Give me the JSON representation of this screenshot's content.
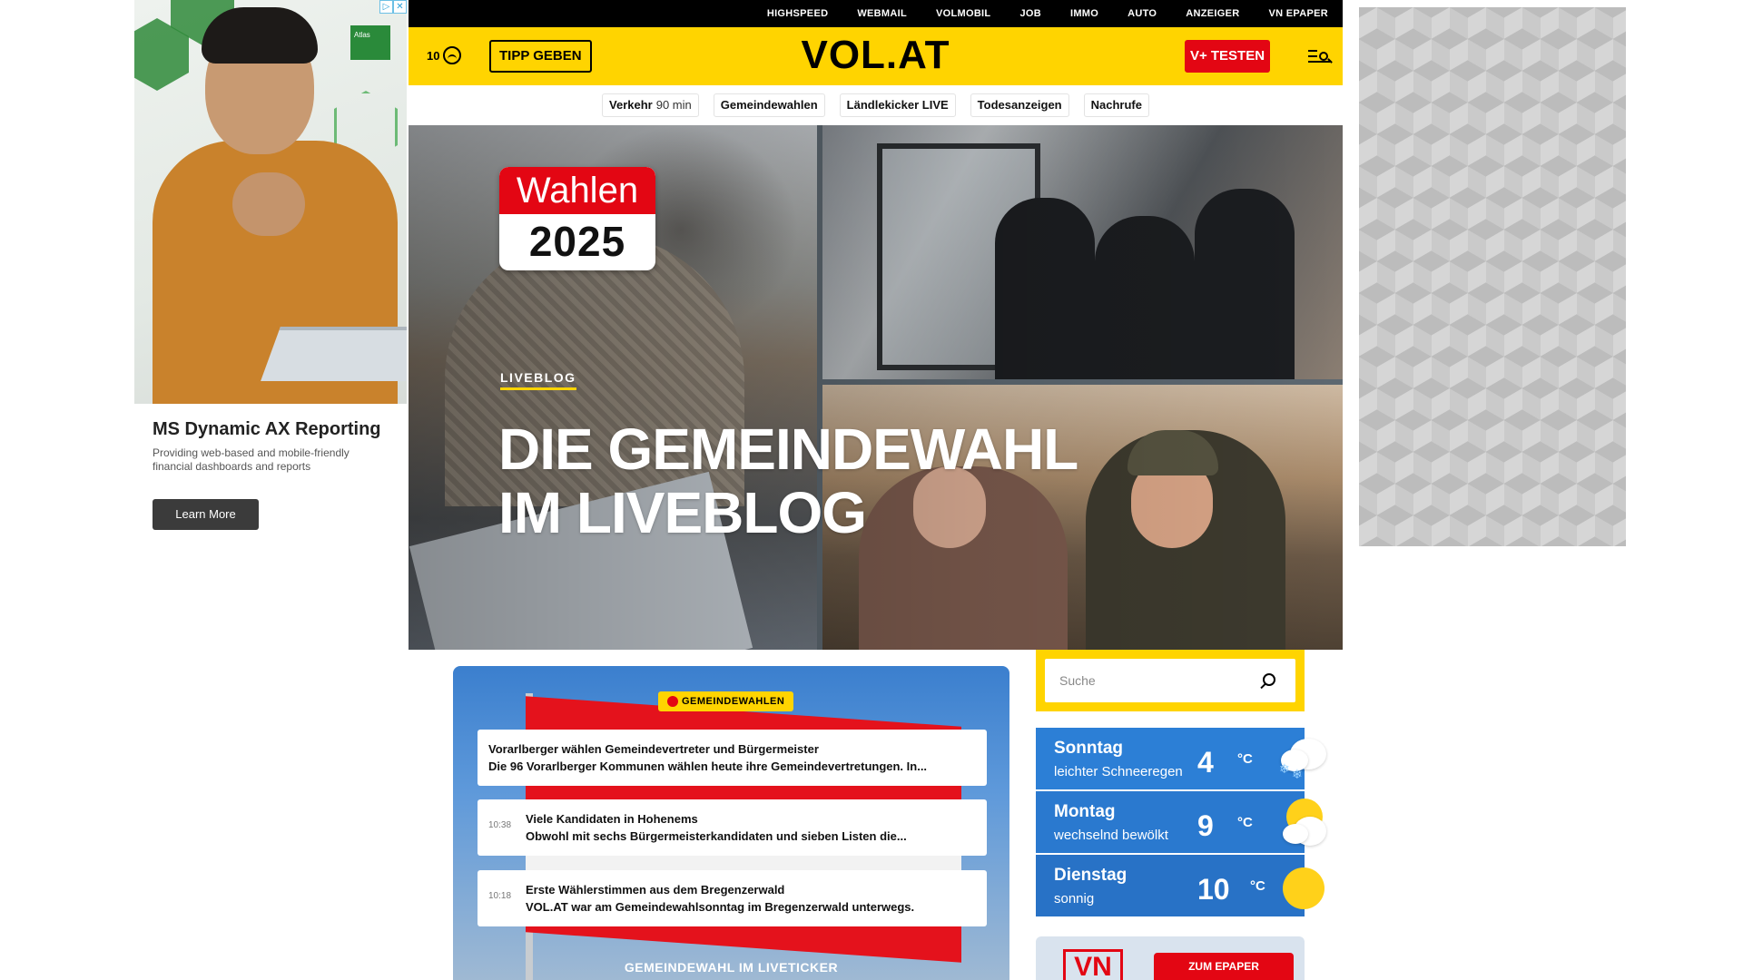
{
  "ad_left": {
    "logo_text": "Atlas",
    "title": "MS Dynamic AX Reporting",
    "description": "Providing web-based and mobile-friendly financial dashboards and reports",
    "cta": "Learn More"
  },
  "topnav": [
    "HIGHSPEED",
    "WEBMAIL",
    "VOLMOBIL",
    "JOB",
    "IMMO",
    "AUTO",
    "ANZEIGER",
    "VN EPAPER"
  ],
  "header": {
    "temperature": "10",
    "tipp_label": "TIPP GEBEN",
    "logo": "VOL.AT",
    "vplus_label": "V+ TESTEN"
  },
  "quicklinks": [
    {
      "label": "Verkehr",
      "sub": "90 min"
    },
    {
      "label": "Gemeindewahlen",
      "sub": ""
    },
    {
      "label": "Ländlekicker LIVE",
      "sub": ""
    },
    {
      "label": "Todesanzeigen",
      "sub": ""
    },
    {
      "label": "Nachrufe",
      "sub": ""
    }
  ],
  "hero": {
    "badge_top": "Wahlen",
    "badge_year": "2025",
    "kicker": "LIVEBLOG",
    "title_line1": "DIE GEMEINDEWAHL",
    "title_line2": "IM LIVEBLOG"
  },
  "ticker": {
    "badge": "GEMEINDEWAHLEN",
    "items": [
      {
        "time": "",
        "title": "Vorarlberger wählen Gemeindevertreter und Bürgermeister",
        "body": "Die 96 Vorarlberger Kommunen wählen heute ihre Gemeindevertretungen. In..."
      },
      {
        "time": "10:38",
        "title": "Viele Kandidaten in Hohenems",
        "body": "Obwohl mit sechs Bürgermeisterkandidaten und sieben Listen die..."
      },
      {
        "time": "10:18",
        "title": "Erste Wählerstimmen aus dem Bregenzerwald",
        "body": "VOL.AT war am Gemeindewahlsonntag im Bregenzerwald unterwegs."
      }
    ],
    "footer": "GEMEINDEWAHL IM LIVETICKER"
  },
  "search": {
    "placeholder": "Suche"
  },
  "weather": [
    {
      "day": "Sonntag",
      "desc": "leichter Schneeregen",
      "temp": "4",
      "unit": "°C",
      "icon": "cloud-snow-icon"
    },
    {
      "day": "Montag",
      "desc": "wechselnd bewölkt",
      "temp": "9",
      "unit": "°C",
      "icon": "sun-cloud-icon"
    },
    {
      "day": "Dienstag",
      "desc": "sonnig",
      "temp": "10",
      "unit": "°C",
      "icon": "sun-icon"
    }
  ],
  "epaper": {
    "logo": "VN",
    "button": "ZUM EPAPER"
  },
  "colors": {
    "brand_yellow": "#ffd400",
    "brand_red": "#e30613",
    "weather_blue": "#2c7fd6"
  }
}
